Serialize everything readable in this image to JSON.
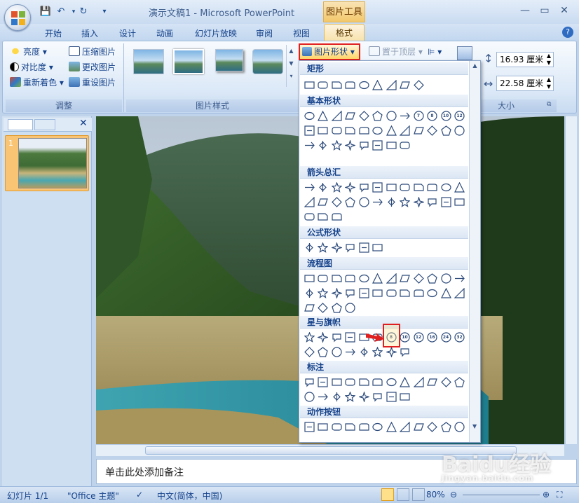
{
  "window": {
    "title": "演示文稿1 - Microsoft PowerPoint",
    "context_tab_title": "图片工具"
  },
  "tabs": [
    "开始",
    "插入",
    "设计",
    "动画",
    "幻灯片放映",
    "审阅",
    "视图",
    "格式"
  ],
  "active_tab": "格式",
  "ribbon": {
    "adjust_group": {
      "label": "调整",
      "buttons": [
        "亮度",
        "对比度",
        "重新着色",
        "压缩图片",
        "更改图片",
        "重设图片"
      ]
    },
    "styles_group": {
      "label": "图片样式"
    },
    "picture_shape_button": "图片形状",
    "bring_to_front": "置于顶层",
    "size_group": {
      "label": "大小",
      "height_value": "16.93 厘米",
      "width_value": "22.58 厘米"
    }
  },
  "shape_menu": {
    "sections": [
      {
        "title": "矩形",
        "count": 9
      },
      {
        "title": "基本形状",
        "count": 32
      },
      {
        "title": "箭头总汇",
        "count": 27
      },
      {
        "title": "公式形状",
        "count": 6
      },
      {
        "title": "流程图",
        "count": 28
      },
      {
        "title": "星与旗帜",
        "count": 20
      },
      {
        "title": "标注",
        "count": 20
      },
      {
        "title": "动作按钮",
        "count": 12
      }
    ],
    "basic_shape_numbers": [
      "7",
      "8",
      "10",
      "12"
    ],
    "star_numbers": [
      "8",
      "10",
      "12",
      "16",
      "24",
      "32"
    ],
    "highlighted_shape": "八角星"
  },
  "slides_panel": {
    "slide_number": "1"
  },
  "notes": {
    "placeholder": "单击此处添加备注"
  },
  "status": {
    "slide_info": "幻灯片 1/1",
    "theme": "\"Office 主题\"",
    "language": "中文(简体，中国)",
    "zoom": "80%"
  },
  "watermark": {
    "text": "Baidu经验",
    "sub": "jingyan.baidu.com"
  }
}
